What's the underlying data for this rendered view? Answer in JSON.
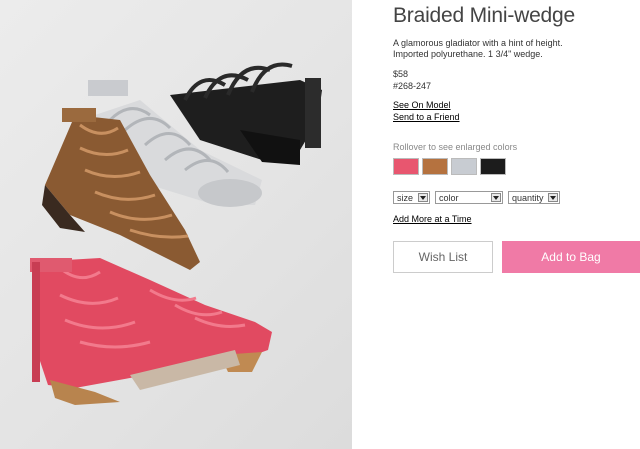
{
  "product": {
    "title": "Braided Mini-wedge",
    "description": "A glamorous gladiator with a hint of height. Imported polyurethane. 1 3/4\" wedge.",
    "price": "$58",
    "sku": "#268-247"
  },
  "links": {
    "see_on_model": "See On Model",
    "send_to_friend": "Send to a Friend",
    "add_more": "Add More at a Time"
  },
  "colors": {
    "rollover_hint": "Rollover to see enlarged colors",
    "swatches": [
      {
        "name": "pink",
        "hex": "#e8566f"
      },
      {
        "name": "bronze",
        "hex": "#b5723f"
      },
      {
        "name": "silver",
        "hex": "#c8ccd2"
      },
      {
        "name": "black",
        "hex": "#1c1c1c"
      }
    ]
  },
  "selects": {
    "size": "size",
    "color": "color",
    "quantity": "quantity"
  },
  "buttons": {
    "wish_list": "Wish List",
    "add_to_bag": "Add to Bag"
  },
  "theme": {
    "accent": "#f07aa6"
  }
}
